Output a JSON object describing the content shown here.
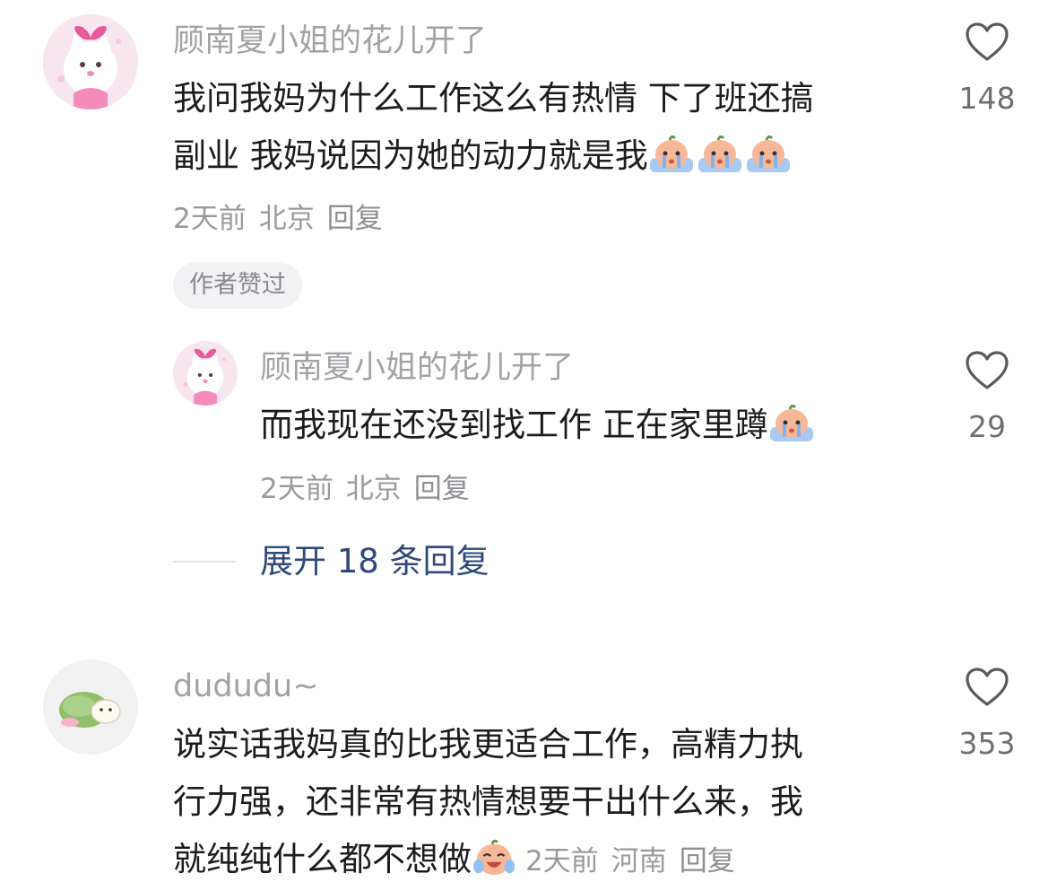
{
  "comments": [
    {
      "username": "顾南夏小姐的花儿开了",
      "lines": [
        "我问我妈为什么工作这么有热情 下了班还搞",
        "副业 我妈说因为她的动力就是我"
      ],
      "emojis": [
        "crying-peach-emoji",
        "crying-peach-emoji",
        "crying-peach-emoji"
      ],
      "time": "2天前",
      "location": "北京",
      "reply_label": "回复",
      "likes": "148",
      "author_badge": "作者赞过",
      "avatar": "pink-cat-avatar"
    },
    {
      "username": "顾南夏小姐的花儿开了",
      "lines": [
        "而我现在还没到找工作 正在家里蹲"
      ],
      "emojis": [
        "crying-peach-emoji"
      ],
      "time": "2天前",
      "location": "北京",
      "reply_label": "回复",
      "likes": "29",
      "avatar": "pink-cat-avatar"
    },
    {
      "username": "dududu~",
      "lines": [
        "说实话我妈真的比我更适合工作，高精力执",
        "行力强，还非常有热情想要干出什么来，我",
        "就纯纯什么都不想做"
      ],
      "emojis": [
        "laugh-cry-peach-emoji"
      ],
      "time": "2天前",
      "location": "河南",
      "reply_label": "回复",
      "likes": "353",
      "avatar": "green-blanket-hamster-avatar"
    }
  ],
  "expand_replies": "展开 18 条回复",
  "colors": {
    "text": "#1c1c1e",
    "username": "#a2a2a6",
    "meta": "#9a9a9e",
    "expand": "#2f4a7a",
    "badge_bg": "#f2f2f4"
  }
}
